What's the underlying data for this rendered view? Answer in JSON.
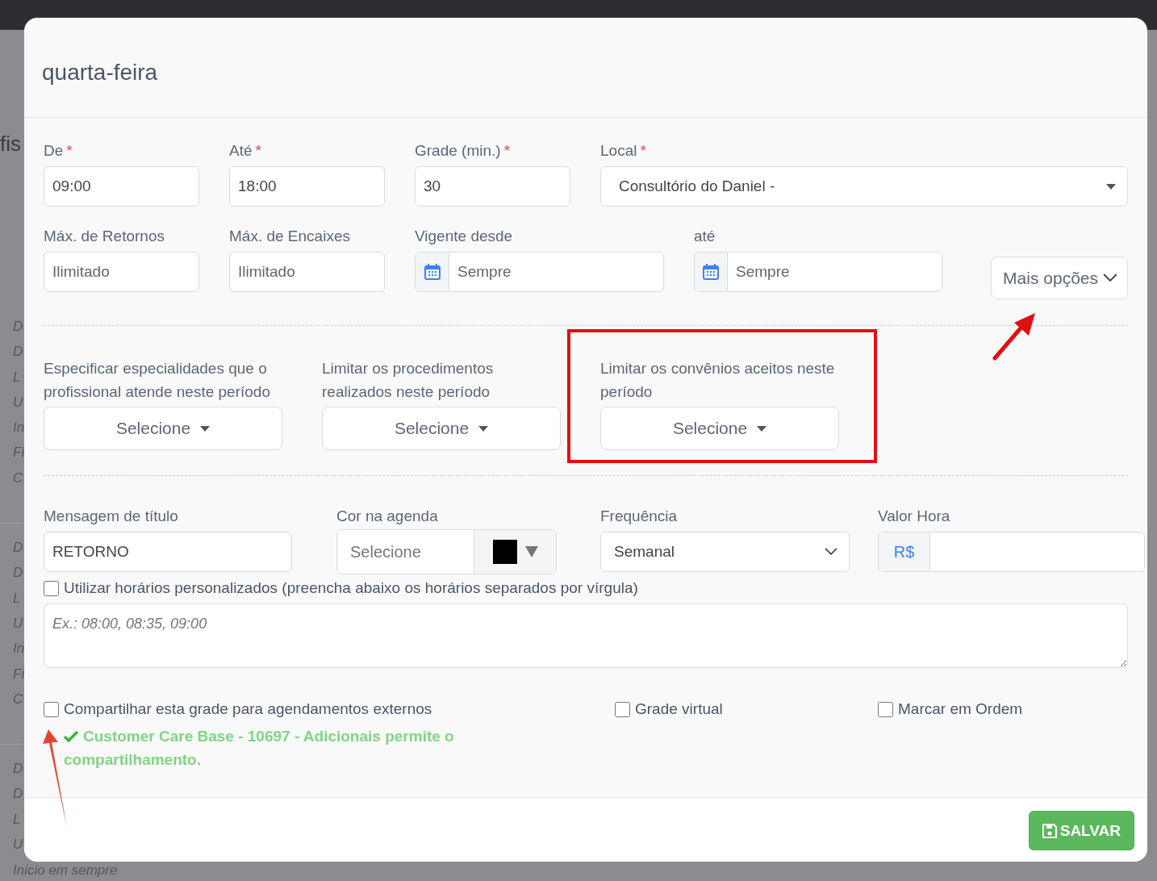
{
  "background": {
    "heading": "fis",
    "groups": [
      [
        "D",
        "D",
        "L",
        "U",
        "In",
        "Fi",
        "C"
      ],
      [
        "D",
        "D",
        "L",
        "U",
        "In",
        "Fi",
        "C"
      ],
      [
        "D",
        "D",
        "L",
        "U"
      ]
    ],
    "footer_text": "Inicio em sempre"
  },
  "modal": {
    "title": "quarta-feira",
    "row1": [
      {
        "label": "De",
        "required_mark": "*",
        "value": "09:00",
        "kind": "text"
      },
      {
        "label": "Até",
        "required_mark": "*",
        "value": "18:00",
        "kind": "text"
      },
      {
        "label": "Grade (min.)",
        "required_mark": "*",
        "value": "30",
        "kind": "text"
      },
      {
        "label": "Local",
        "required_mark": "*",
        "value": "Consultório do Daniel -",
        "kind": "select"
      }
    ],
    "row2": [
      {
        "label": "Máx. de Retornos",
        "placeholder": "Ilimitado",
        "kind": "text"
      },
      {
        "label": "Máx. de Encaixes",
        "placeholder": "Ilimitado",
        "kind": "text"
      },
      {
        "label": "Vigente desde",
        "placeholder": "Sempre",
        "kind": "date"
      },
      {
        "label": "até",
        "placeholder": "Sempre",
        "kind": "date"
      }
    ],
    "more_options": "Mais opções",
    "filters": [
      {
        "label": "Especificar especialidades que o profissional atende neste período",
        "button": "Selecione",
        "highlighted": false
      },
      {
        "label": "Limitar os procedimentos realizados neste período",
        "button": "Selecione",
        "highlighted": false
      },
      {
        "label": "Limitar os convênios aceitos neste período",
        "button": "Selecione",
        "highlighted": true
      }
    ],
    "title_message": {
      "label": "Mensagem de título",
      "value": "RETORNO"
    },
    "color_field": {
      "label": "Cor na agenda",
      "placeholder": "Selecione",
      "color": "#000000"
    },
    "frequency": {
      "label": "Frequência",
      "value": "Semanal"
    },
    "hourly_value": {
      "label": "Valor Hora",
      "prefix": "R$"
    },
    "custom_hours": {
      "label": "Utilizar horários personalizados (preencha abaixo os horários separados por vírgula)",
      "checked": false,
      "placeholder": "Ex.: 08:00, 08:35, 09:00"
    },
    "options": [
      {
        "label": "Compartilhar esta grade para agendamentos externos",
        "checked": false
      },
      {
        "label": "Grade virtual",
        "checked": false
      },
      {
        "label": "Marcar em Ordem",
        "checked": false
      }
    ],
    "share_notice": "Customer Care Base - 10697 - Adicionais permite o compartilhamento.",
    "save_button": "SALVAR"
  }
}
